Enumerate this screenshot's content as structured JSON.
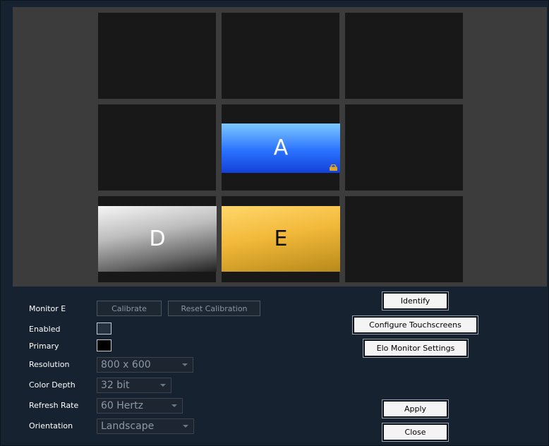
{
  "monitors": {
    "a": {
      "label": "A",
      "color": "#2a72ff",
      "locked": true,
      "lock_icon": "lock-icon"
    },
    "d": {
      "label": "D",
      "color": "#9a9a9a"
    },
    "e": {
      "label": "E",
      "color": "#f2b93a"
    }
  },
  "settings": {
    "monitor_label": "Monitor E",
    "calibrate_label": "Calibrate",
    "reset_calibration_label": "Reset Calibration",
    "enabled_label": "Enabled",
    "enabled_checked": false,
    "primary_label": "Primary",
    "primary_checked": false,
    "resolution_label": "Resolution",
    "resolution_value": "800 x 600",
    "color_depth_label": "Color Depth",
    "color_depth_value": "32 bit",
    "refresh_rate_label": "Refresh Rate",
    "refresh_rate_value": "60 Hertz",
    "orientation_label": "Orientation",
    "orientation_value": "Landscape"
  },
  "actions": {
    "identify_label": "Identify",
    "configure_touchscreens_label": "Configure Touchscreens",
    "elo_monitor_settings_label": "Elo Monitor Settings",
    "apply_label": "Apply",
    "close_label": "Close"
  }
}
